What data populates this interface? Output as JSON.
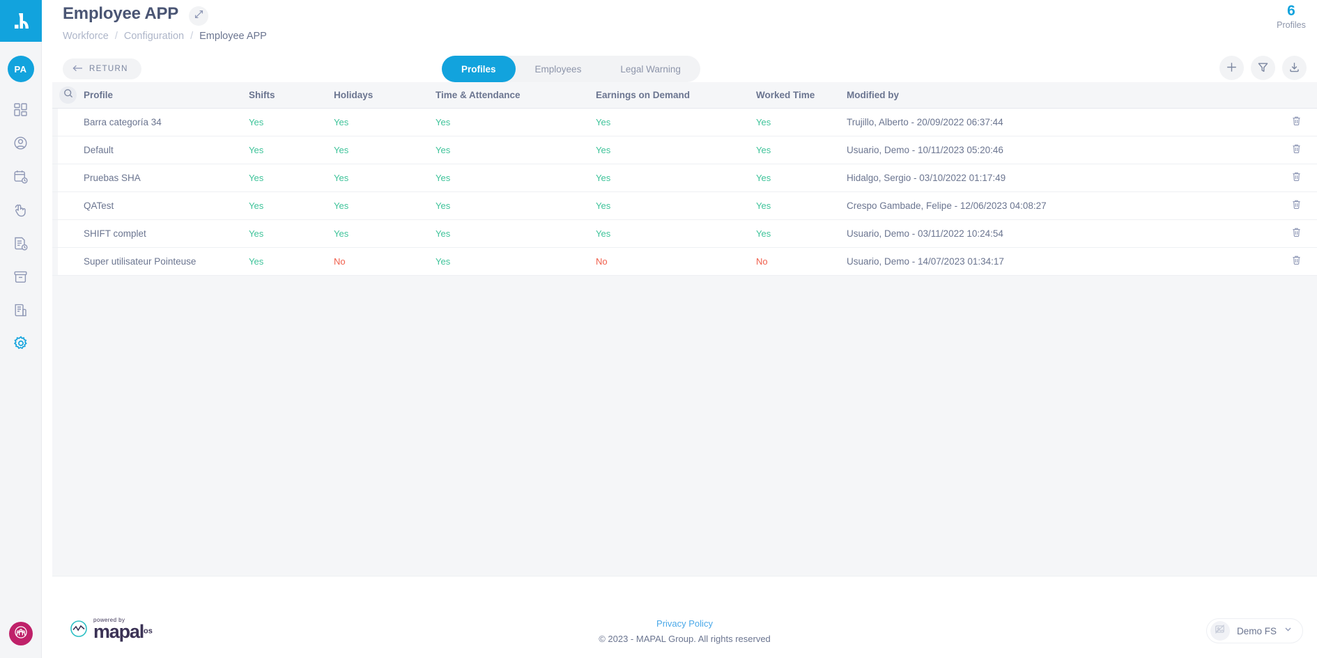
{
  "sidebar": {
    "brand_icon": "mapal-logo-icon",
    "avatar_initials": "PA",
    "nav_items": [
      {
        "icon": "dashboard-grid-icon",
        "active": false
      },
      {
        "icon": "user-circle-icon",
        "active": false
      },
      {
        "icon": "calendar-clock-icon",
        "active": false
      },
      {
        "icon": "hand-click-icon",
        "active": false
      },
      {
        "icon": "document-clock-icon",
        "active": false
      },
      {
        "icon": "archive-box-icon",
        "active": false
      },
      {
        "icon": "report-document-icon",
        "active": false
      },
      {
        "icon": "gear-icon",
        "active": true
      }
    ],
    "org_badge_icon": "people-group-icon",
    "org_badge_color": "#bf2169",
    "brand_color": "#12a3dd"
  },
  "header": {
    "title": "Employee APP",
    "expand_icon": "expand-arrows-icon",
    "breadcrumb": [
      "Workforce",
      "Configuration",
      "Employee APP"
    ],
    "breadcrumb_separator": "/",
    "return_label": "RETURN",
    "return_icon": "arrow-left-icon"
  },
  "tabs": [
    {
      "label": "Profiles",
      "active": true
    },
    {
      "label": "Employees",
      "active": false
    },
    {
      "label": "Legal Warning",
      "active": false
    }
  ],
  "counter": {
    "value": "6",
    "label": "Profiles",
    "color": "#12a3dd"
  },
  "top_actions": [
    {
      "icon": "plus-icon",
      "name": "add-profile-button"
    },
    {
      "icon": "filter-funnel-icon",
      "name": "filter-button"
    },
    {
      "icon": "download-icon",
      "name": "export-button"
    }
  ],
  "table": {
    "search_icon": "search-icon",
    "columns": [
      "Profile",
      "Shifts",
      "Holidays",
      "Time & Attendance",
      "Earnings on Demand",
      "Worked Time",
      "Modified by"
    ],
    "delete_icon": "trash-icon",
    "rows": [
      {
        "profile": "Barra categoría 34",
        "shifts": "Yes",
        "holidays": "Yes",
        "time_attendance": "Yes",
        "earnings_on_demand": "Yes",
        "worked_time": "Yes",
        "modified_by": "Trujillo, Alberto - 20/09/2022 06:37:44"
      },
      {
        "profile": "Default",
        "shifts": "Yes",
        "holidays": "Yes",
        "time_attendance": "Yes",
        "earnings_on_demand": "Yes",
        "worked_time": "Yes",
        "modified_by": "Usuario, Demo - 10/11/2023 05:20:46"
      },
      {
        "profile": "Pruebas SHA",
        "shifts": "Yes",
        "holidays": "Yes",
        "time_attendance": "Yes",
        "earnings_on_demand": "Yes",
        "worked_time": "Yes",
        "modified_by": "Hidalgo, Sergio - 03/10/2022 01:17:49"
      },
      {
        "profile": "QATest",
        "shifts": "Yes",
        "holidays": "Yes",
        "time_attendance": "Yes",
        "earnings_on_demand": "Yes",
        "worked_time": "Yes",
        "modified_by": "Crespo Gambade, Felipe - 12/06/2023 04:08:27"
      },
      {
        "profile": "SHIFT complet",
        "shifts": "Yes",
        "holidays": "Yes",
        "time_attendance": "Yes",
        "earnings_on_demand": "Yes",
        "worked_time": "Yes",
        "modified_by": "Usuario, Demo - 03/11/2022 10:24:54"
      },
      {
        "profile": "Super utilisateur Pointeuse",
        "shifts": "Yes",
        "holidays": "No",
        "time_attendance": "Yes",
        "earnings_on_demand": "No",
        "worked_time": "No",
        "modified_by": "Usuario, Demo - 14/07/2023 01:34:17"
      }
    ],
    "yes_color": "#3fc39a",
    "no_color": "#f0604d"
  },
  "footer": {
    "powered_by": "powered by",
    "brand_word": "mapal",
    "brand_suffix": "os",
    "brand_icon": "mapal-wave-icon",
    "privacy_label": "Privacy Policy",
    "copyright": "© 2023 - MAPAL Group. All rights reserved",
    "org_name": "Demo FS",
    "org_thumb_icon": "image-placeholder-icon",
    "org_chevron_icon": "chevron-down-icon"
  }
}
